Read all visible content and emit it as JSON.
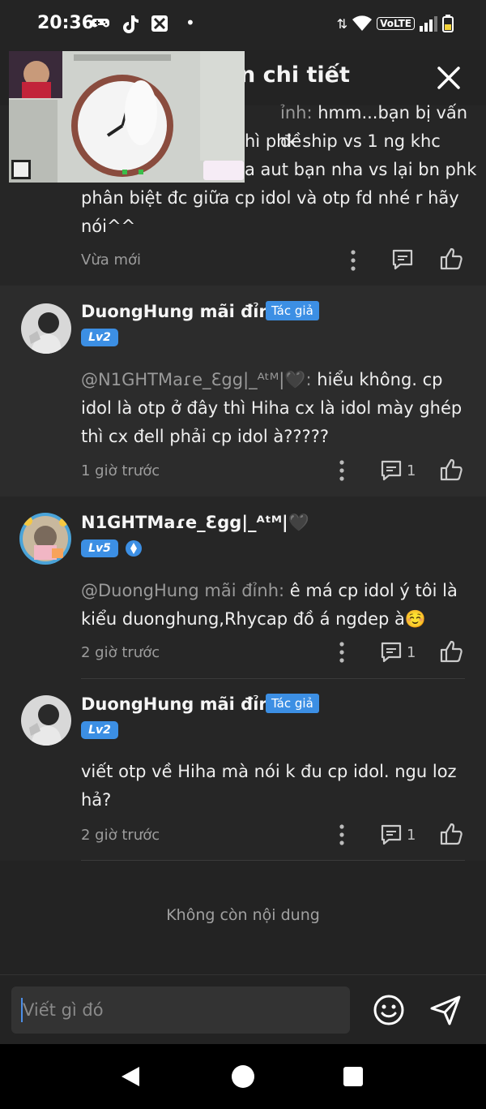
{
  "status_bar": {
    "time": "20:36",
    "dot": "•",
    "network_badge": "VoLTE"
  },
  "header": {
    "title": "n chi tiết"
  },
  "comments": [
    {
      "mention": "ỉnh:",
      "lines": [
        "hmm...bạn bị vấn đề",
        "hì phk ship vs 1 ng khc",
        "a aut bạn nha vs lại bn phk",
        "phân biệt đc giữa cp idol và otp fd nhé r hãy",
        "nói^^"
      ],
      "time": "Vừa mới"
    },
    {
      "username": "DuongHung mãi đỉnh",
      "author_badge": "Tác giả",
      "level": "Lv2",
      "mention": "@N1GHTMaɾe_Ɛgg|_ᴬᵗᴹ|🖤:",
      "text": "hiểu không. cp idol là otp ở đây thì Hiha cx là idol mày ghép thì cx đell phải cp idol à?????",
      "time": "1 giờ trước",
      "reply_count": "1"
    },
    {
      "username": "N1GHTMaɾe_Ɛgg|_ᴬᵗᴹ|🖤",
      "level": "Lv5",
      "mention": "@DuongHung mãi đỉnh:",
      "text": "ê má cp idol ý tôi là kiểu duonghung,Rhycap đồ á ngdep à☺️",
      "time": "2 giờ trước",
      "reply_count": "1"
    },
    {
      "username": "DuongHung mãi đỉnh",
      "author_badge": "Tác giả",
      "level": "Lv2",
      "text": "viết otp về Hiha mà nói k đu cp idol. ngu loz hả?",
      "time": "2 giờ trước",
      "reply_count": "1"
    }
  ],
  "no_more_text": "Không còn nội dung",
  "input": {
    "placeholder": "Viết gì đó"
  },
  "colors": {
    "accent": "#3c8fe4",
    "background": "#232323"
  }
}
